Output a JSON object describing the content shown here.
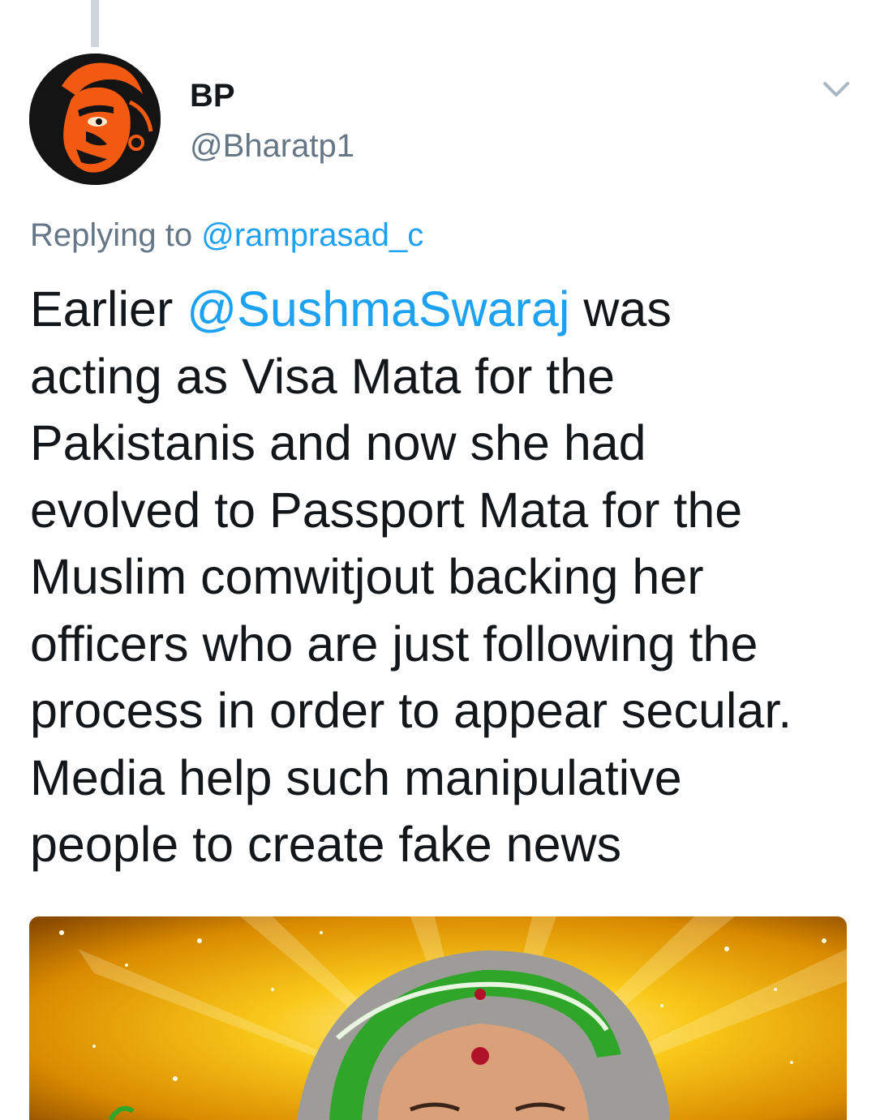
{
  "tweet": {
    "author": {
      "display_name": "BP",
      "handle": "@Bharatp1"
    },
    "reply": {
      "prefix": "Replying to",
      "to_handle": "@ramprasad_c"
    },
    "text_lines": [
      {
        "before": "Earlier",
        "mention": "@SushmaSwaraj",
        "after": "was"
      },
      {
        "text": "acting as Visa Mata for the"
      },
      {
        "text": "Pakistanis and now she had"
      },
      {
        "text": "evolved to Passport Mata for the"
      },
      {
        "text": "Muslim comwitjout backing her"
      },
      {
        "text": "officers who are just following the"
      },
      {
        "text": "process in order to appear secular."
      },
      {
        "text": "Media help such manipulative"
      },
      {
        "text": "people to create fake news"
      }
    ]
  },
  "colors": {
    "text_primary": "#14171a",
    "text_secondary": "#657786",
    "link": "#1da1f2",
    "thread_line": "#cdd6dd",
    "avatar_bg": "#141414",
    "avatar_accent": "#f25a12",
    "media_gold": "#f5b000",
    "headscarf_green": "#2fa52a",
    "bindi_red": "#b0122a"
  },
  "icons": {
    "avatar": "hanuman-portrait",
    "menu": "chevron-down-icon"
  }
}
